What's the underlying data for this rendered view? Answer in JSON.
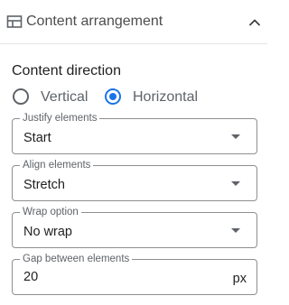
{
  "header": {
    "title": "Content arrangement",
    "icon": "table-layout-icon",
    "collapse_icon": "chevron-up-icon"
  },
  "content_direction": {
    "label": "Content direction",
    "options": [
      {
        "label": "Vertical",
        "checked": false
      },
      {
        "label": "Horizontal",
        "checked": true
      }
    ]
  },
  "fields": {
    "justify": {
      "label": "Justify elements",
      "value": "Start"
    },
    "align": {
      "label": "Align elements",
      "value": "Stretch"
    },
    "wrap": {
      "label": "Wrap option",
      "value": "No wrap"
    },
    "gap": {
      "label": "Gap between elements",
      "value": "20",
      "unit": "px"
    }
  },
  "colors": {
    "accent": "#1a73e8",
    "border": "#8f8f8f",
    "muted_text": "#5f6368"
  }
}
